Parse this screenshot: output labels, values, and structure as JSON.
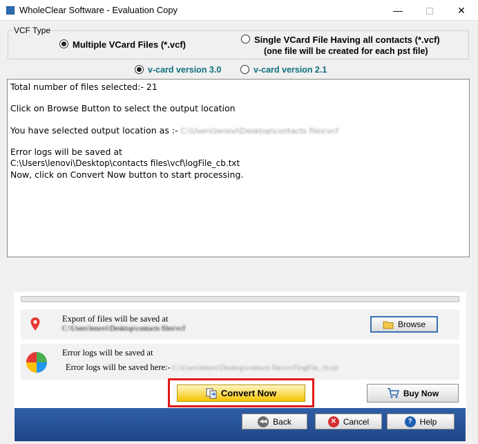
{
  "window": {
    "title": "WholeClear Software - Evaluation Copy",
    "minimize_glyph": "—",
    "close_glyph": "✕"
  },
  "vcf_type": {
    "legend": "VCF Type",
    "option_multiple": "Multiple VCard Files (*.vcf)",
    "option_single_line1": "Single VCard File Having all contacts (*.vcf)",
    "option_single_line2": "(one file will be created for each pst file)",
    "selected": "multiple"
  },
  "version": {
    "option_v3": "v-card version 3.0",
    "option_v21": "v-card version 2.1",
    "selected": "3.0"
  },
  "log": {
    "line_total": "Total number of files selected:- 21",
    "line_browse": "Click on Browse Button to select the output location",
    "line_selected_prefix": "You have selected output location as :-",
    "line_selected_path": "C:\\Users\\lenovi\\Desktop\\contacts files\\vcf",
    "line_error_header": "Error logs will be saved at",
    "line_error_path": "C:\\Users\\lenovi\\Desktop\\contacts files\\vcf\\logFile_cb.txt",
    "line_convert": "Now, click on Convert Now button to start processing."
  },
  "progress": {
    "fraction": 0.0
  },
  "export_row": {
    "icon": "location-pin-icon",
    "heading": "Export of files will be saved at",
    "path": "C:\\Users\\lenovi\\Desktop\\contacts files\\vcf",
    "browse_label": "Browse"
  },
  "error_row": {
    "icon": "pie-chart-icon",
    "heading": "Error logs will be saved at",
    "prefix": "Error logs will be saved here:-",
    "path": "C:\\Users\\lenovi\\Desktop\\contacts files\\vcf\\logFile_cb.txt"
  },
  "actions": {
    "convert_label": "Convert Now",
    "buy_label": "Buy Now",
    "back_label": "Back",
    "cancel_label": "Cancel",
    "help_label": "Help"
  },
  "colors": {
    "accent_teal": "#0f6f80",
    "footer_blue": "#2f5fa6",
    "convert_yellow": "#f5c400",
    "highlight_red": "#e01818"
  }
}
